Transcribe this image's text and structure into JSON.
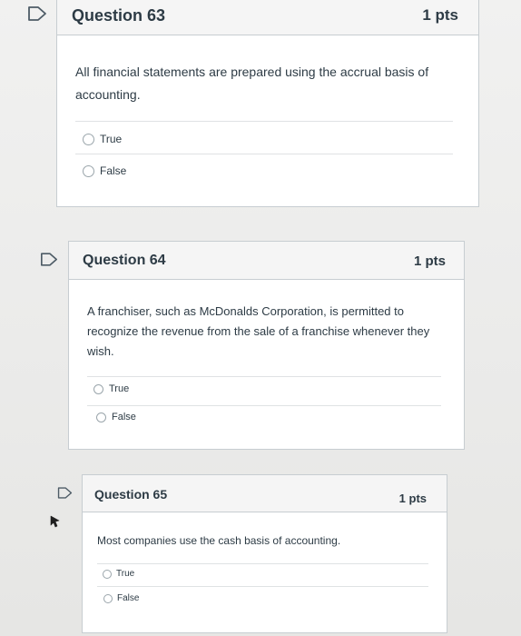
{
  "questions": [
    {
      "title": "Question 63",
      "points": "1 pts",
      "text": "All financial statements are prepared using the accrual basis of accounting.",
      "answers": [
        "True",
        "False"
      ]
    },
    {
      "title": "Question 64",
      "points": "1 pts",
      "text": "A franchiser, such as McDonalds Corporation, is permitted to recognize the revenue from the sale of a franchise whenever they wish.",
      "answers": [
        "True",
        "False"
      ]
    },
    {
      "title": "Question 65",
      "points": "1 pts",
      "text": "Most companies use the cash basis of accounting.",
      "answers": [
        "True",
        "False"
      ]
    }
  ],
  "colors": {
    "text": "#2d3b45",
    "border": "#c7cdd1",
    "header_bg": "#f5f5f5",
    "flag": "#4d5b66"
  },
  "icons": {
    "flag": "flag-outline-icon",
    "cursor": "mouse-pointer-icon"
  }
}
